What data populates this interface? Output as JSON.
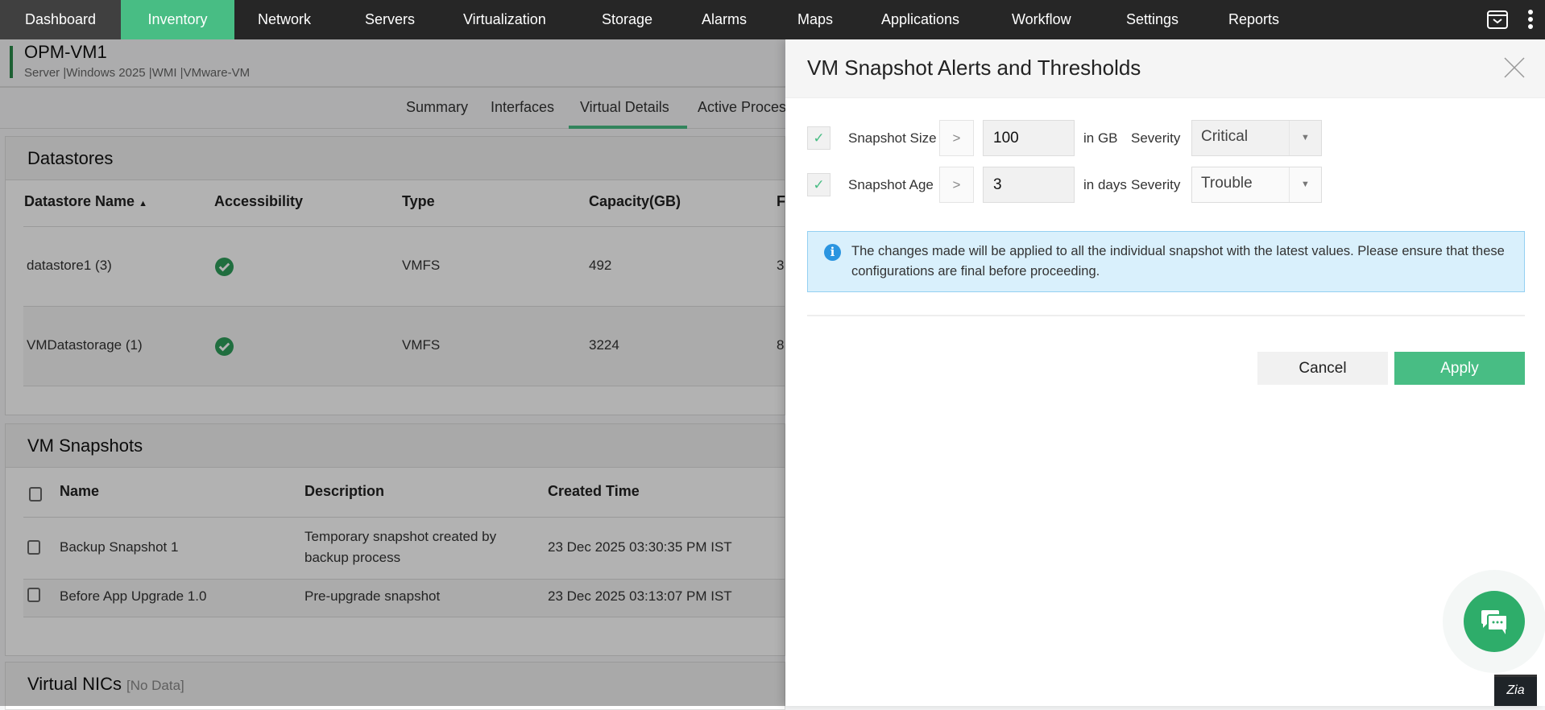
{
  "nav": {
    "items": [
      "Dashboard",
      "Inventory",
      "Network",
      "Servers",
      "Virtualization",
      "Storage",
      "Alarms",
      "Maps",
      "Applications",
      "Workflow",
      "Settings",
      "Reports"
    ],
    "active": "Inventory"
  },
  "device": {
    "name": "OPM-VM1",
    "tags": "Server |Windows 2025  |WMI  |VMware-VM"
  },
  "tabs": [
    "Summary",
    "Interfaces",
    "Virtual Details",
    "Active Proces"
  ],
  "datastores": {
    "title": "Datastores",
    "columns": [
      "Datastore Name",
      "Accessibility",
      "Type",
      "Capacity(GB)",
      "F"
    ],
    "rows": [
      {
        "name": "datastore1 (3)",
        "type": "VMFS",
        "capacity": "492",
        "free": "3"
      },
      {
        "name": "VMDatastorage (1)",
        "type": "VMFS",
        "capacity": "3224",
        "free": "8"
      }
    ]
  },
  "snapshots": {
    "title": "VM Snapshots",
    "columns": [
      "Name",
      "Description",
      "Created Time"
    ],
    "rows": [
      {
        "name": "Backup Snapshot 1",
        "description": "Temporary snapshot created by backup process",
        "created": "23 Dec 2025 03:30:35 PM IST"
      },
      {
        "name": "Before App Upgrade 1.0",
        "description": "Pre-upgrade snapshot",
        "created": "23 Dec 2025 03:13:07 PM IST"
      }
    ]
  },
  "nics": {
    "title": "Virtual NICs",
    "nodata": "[No Data]"
  },
  "dialog": {
    "title": "VM Snapshot Alerts and Thresholds",
    "rows": [
      {
        "label": "Snapshot Size",
        "op": ">",
        "value": "100",
        "unit": "in GB",
        "severity_label": "Severity",
        "severity": "Critical",
        "checked": true
      },
      {
        "label": "Snapshot Age",
        "op": ">",
        "value": "3",
        "unit": "in days",
        "severity_label": "Severity",
        "severity": "Trouble",
        "checked": true
      }
    ],
    "info": "The changes made will be applied to all the individual snapshot with the latest values. Please ensure that these configurations are final before proceeding.",
    "cancel": "Cancel",
    "apply": "Apply"
  },
  "zia": "Zia",
  "colors": {
    "accent": "#48bd84",
    "nav": "#262626",
    "info_bg": "#d9f0fc"
  }
}
